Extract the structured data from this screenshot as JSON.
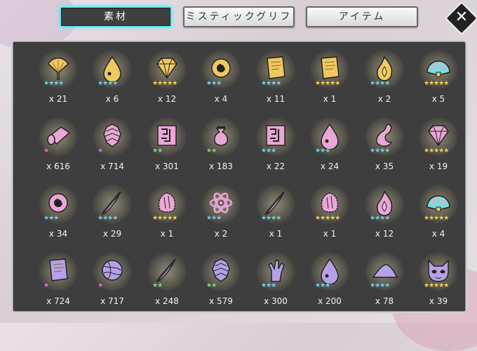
{
  "tabs": [
    {
      "label": "素材",
      "active": true
    },
    {
      "label": "ミスティックグリフ",
      "active": false
    },
    {
      "label": "アイテム",
      "active": false
    }
  ],
  "close_label": "✕",
  "colors": {
    "gold": "#f0c860",
    "pink": "#e9a6d6",
    "lavender": "#b7a0e6",
    "cyan": "#5fe8f0"
  },
  "items": [
    {
      "icon": "ginkgo-leaf-icon",
      "color": "gold",
      "stars": "★★★★",
      "starcolor": "#6fd0ea",
      "qty": "x 21"
    },
    {
      "icon": "drop-icon",
      "color": "gold",
      "stars": "★★★★",
      "starcolor": "#6fd0ea",
      "qty": "x 6"
    },
    {
      "icon": "diamond-icon",
      "color": "gold",
      "stars": "★★★★★",
      "starcolor": "#f0d050",
      "qty": "x 12"
    },
    {
      "icon": "swirl-orb-icon",
      "color": "gold",
      "stars": "★★★",
      "starcolor": "#6fd0ea",
      "qty": "x 4"
    },
    {
      "icon": "scroll-icon",
      "color": "gold",
      "stars": "★★★★",
      "starcolor": "#6fd0ea",
      "qty": "x 11"
    },
    {
      "icon": "scroll-icon",
      "color": "gold",
      "stars": "★★★★★",
      "starcolor": "#f0d050",
      "qty": "x 1"
    },
    {
      "icon": "flame-icon",
      "color": "gold",
      "stars": "★★★★",
      "starcolor": "#6fd0ea",
      "qty": "x 2"
    },
    {
      "icon": "peacock-fan-icon",
      "color": "cyan",
      "stars": "★★★★★",
      "starcolor": "#f0d050",
      "qty": "x 5"
    },
    {
      "icon": "cloth-roll-icon",
      "color": "pink",
      "stars": "★",
      "starcolor": "#e070d0",
      "qty": "x 616"
    },
    {
      "icon": "scales-icon",
      "color": "pink",
      "stars": "★",
      "starcolor": "#e070d0",
      "qty": "x 714"
    },
    {
      "icon": "rune-tablet-icon",
      "color": "pink",
      "stars": "★★",
      "starcolor": "#7fd87f",
      "qty": "x 301"
    },
    {
      "icon": "pouch-icon",
      "color": "pink",
      "stars": "★★",
      "starcolor": "#7fd87f",
      "qty": "x 183"
    },
    {
      "icon": "rune-tablet-icon",
      "color": "pink",
      "stars": "★★★",
      "starcolor": "#6fd0ea",
      "qty": "x 22"
    },
    {
      "icon": "drop-icon",
      "color": "pink",
      "stars": "★★★",
      "starcolor": "#6fd0ea",
      "qty": "x 24"
    },
    {
      "icon": "tail-icon",
      "color": "pink",
      "stars": "★★★★",
      "starcolor": "#6fd0ea",
      "qty": "x 35"
    },
    {
      "icon": "diamond-icon",
      "color": "pink",
      "stars": "★★★★★",
      "starcolor": "#f0d050",
      "qty": "x 19"
    },
    {
      "icon": "swirl-orb-icon",
      "color": "pink",
      "stars": "★★★",
      "starcolor": "#6fd0ea",
      "qty": "x 34"
    },
    {
      "icon": "feather-icon",
      "color": "pink",
      "stars": "★★★★",
      "starcolor": "#6fd0ea",
      "qty": "x 29"
    },
    {
      "icon": "fur-tuft-icon",
      "color": "pink",
      "stars": "★★★★★",
      "starcolor": "#f0d050",
      "qty": "x 1"
    },
    {
      "icon": "atom-icon",
      "color": "pink",
      "stars": "★★★",
      "starcolor": "#6fd0ea",
      "qty": "x 2"
    },
    {
      "icon": "feather-icon",
      "color": "pink",
      "stars": "★★★★",
      "starcolor": "#6fd0ea",
      "qty": "x 1"
    },
    {
      "icon": "fur-tuft-icon",
      "color": "pink",
      "stars": "★★★★★",
      "starcolor": "#f0d050",
      "qty": "x 1"
    },
    {
      "icon": "flame-icon",
      "color": "pink",
      "stars": "★★★★",
      "starcolor": "#6fd0ea",
      "qty": "x 12"
    },
    {
      "icon": "peacock-fan-icon",
      "color": "cyan",
      "stars": "★★★★★",
      "starcolor": "#f0d050",
      "qty": "x 4"
    },
    {
      "icon": "scroll-icon",
      "color": "lavender",
      "stars": "★",
      "starcolor": "#e070d0",
      "qty": "x 724"
    },
    {
      "icon": "yarn-ball-icon",
      "color": "lavender",
      "stars": "★",
      "starcolor": "#e070d0",
      "qty": "x 717"
    },
    {
      "icon": "feather-icon",
      "color": "lavender",
      "stars": "★★",
      "starcolor": "#7fd87f",
      "qty": "x 248"
    },
    {
      "icon": "scales-icon",
      "color": "lavender",
      "stars": "★★",
      "starcolor": "#7fd87f",
      "qty": "x 579"
    },
    {
      "icon": "hand-icon",
      "color": "lavender",
      "stars": "★★★",
      "starcolor": "#6fd0ea",
      "qty": "x 300"
    },
    {
      "icon": "drop-icon",
      "color": "lavender",
      "stars": "★★★",
      "starcolor": "#6fd0ea",
      "qty": "x 200"
    },
    {
      "icon": "sand-pile-icon",
      "color": "lavender",
      "stars": "★★★★",
      "starcolor": "#6fd0ea",
      "qty": "x 78"
    },
    {
      "icon": "mask-icon",
      "color": "lavender",
      "stars": "★★★★★",
      "starcolor": "#f0d050",
      "qty": "x 39"
    }
  ]
}
